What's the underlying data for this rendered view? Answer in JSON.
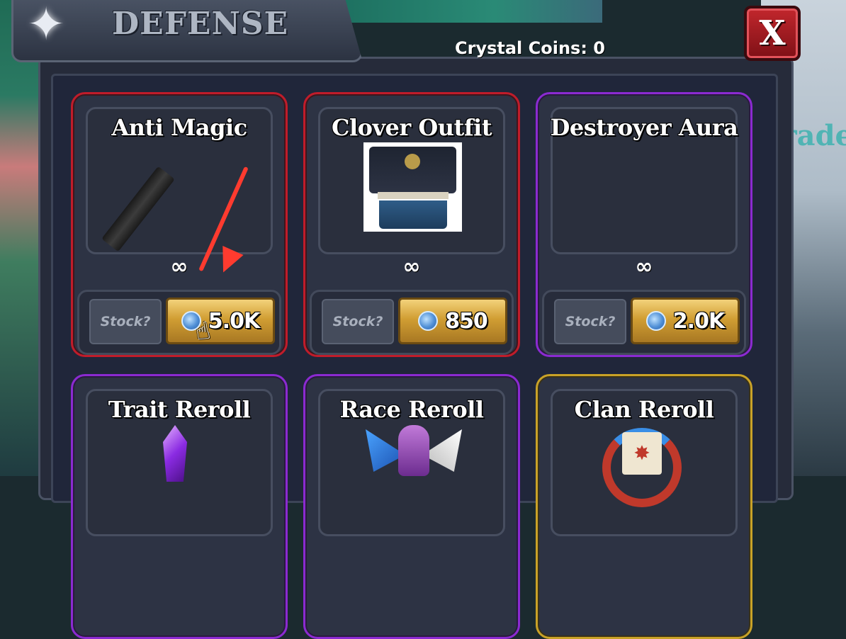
{
  "panel": {
    "title": "DEFENSE",
    "close_label": "X",
    "currency_text": "Crystal Coins: 0",
    "stock_label": "Stock?",
    "infinite_symbol": "∞"
  },
  "background": {
    "partial_text": "grade"
  },
  "items": [
    {
      "name": "Anti Magic",
      "price": "5.0K",
      "rarity_color": "#c01c2a"
    },
    {
      "name": "Clover Outfit",
      "price": "850",
      "rarity_color": "#c01c2a"
    },
    {
      "name": "Destroyer Aura",
      "price": "2.0K",
      "rarity_color": "#8b2ad1"
    },
    {
      "name": "Trait Reroll",
      "rarity_color": "#8b2ad1"
    },
    {
      "name": "Race Reroll",
      "rarity_color": "#8b2ad1"
    },
    {
      "name": "Clan Reroll",
      "rarity_color": "#c9a227"
    }
  ],
  "icons": {
    "header": "four-point-star-icon",
    "coin": "crystal-coin-icon",
    "annotation": "red-arrow-icon",
    "cursor": "hand-cursor-icon"
  }
}
